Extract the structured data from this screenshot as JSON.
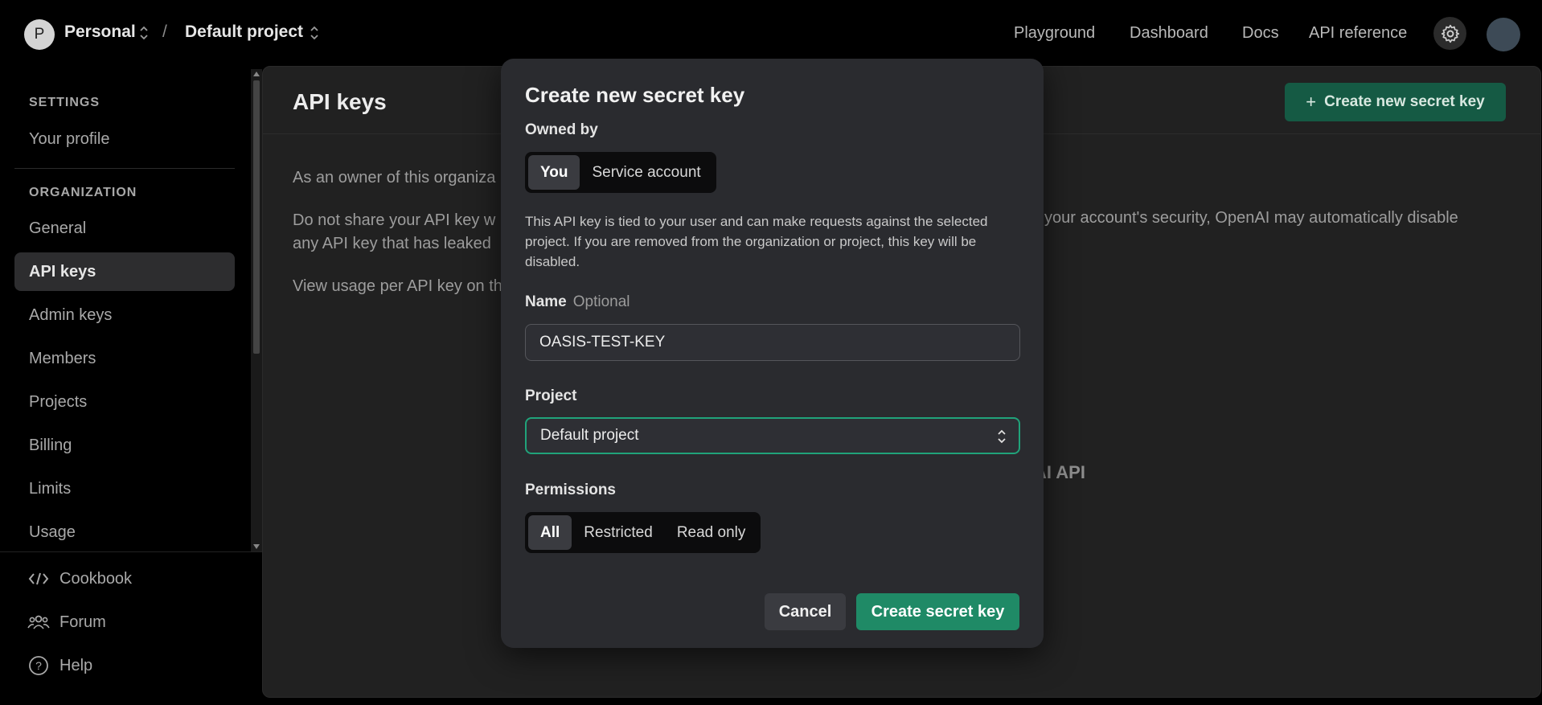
{
  "topbar": {
    "workspace_initial": "P",
    "workspace": "Personal",
    "separator": "/",
    "project": "Default project",
    "links": [
      "Playground",
      "Dashboard",
      "Docs",
      "API reference"
    ]
  },
  "sidebar": {
    "settings_heading": "SETTINGS",
    "your_profile": "Your profile",
    "org_heading": "ORGANIZATION",
    "items": [
      "General",
      "API keys",
      "Admin keys",
      "Members",
      "Projects",
      "Billing",
      "Limits",
      "Usage"
    ],
    "active": "API keys",
    "footer": [
      "Cookbook",
      "Forum",
      "Help"
    ]
  },
  "main": {
    "title": "API keys",
    "create_button": "Create new secret key",
    "line1": "As an owner of this organiza",
    "line2_left": "Do not share your API key w",
    "line2_right": "your account's security, OpenAI may automatically disable",
    "line3": "any API key that has leaked",
    "line4": "View usage per API key on th",
    "empty_fragment": "AI API"
  },
  "modal": {
    "title": "Create new secret key",
    "owned_by_label": "Owned by",
    "owned_by_options": [
      "You",
      "Service account"
    ],
    "owned_by_selected": "You",
    "description": "This API key is tied to your user and can make requests against the selected project. If you are removed from the organization or project, this key will be disabled.",
    "name_label": "Name",
    "name_optional": "Optional",
    "name_value": "OASIS-TEST-KEY",
    "project_label": "Project",
    "project_value": "Default project",
    "permissions_label": "Permissions",
    "permission_options": [
      "All",
      "Restricted",
      "Read only"
    ],
    "permission_selected": "All",
    "cancel": "Cancel",
    "create": "Create secret key"
  },
  "colors": {
    "accent_green": "#1f8a66",
    "focus_border": "#20a37a",
    "modal_bg": "#2a2b2f",
    "page_bg": "#000000"
  }
}
